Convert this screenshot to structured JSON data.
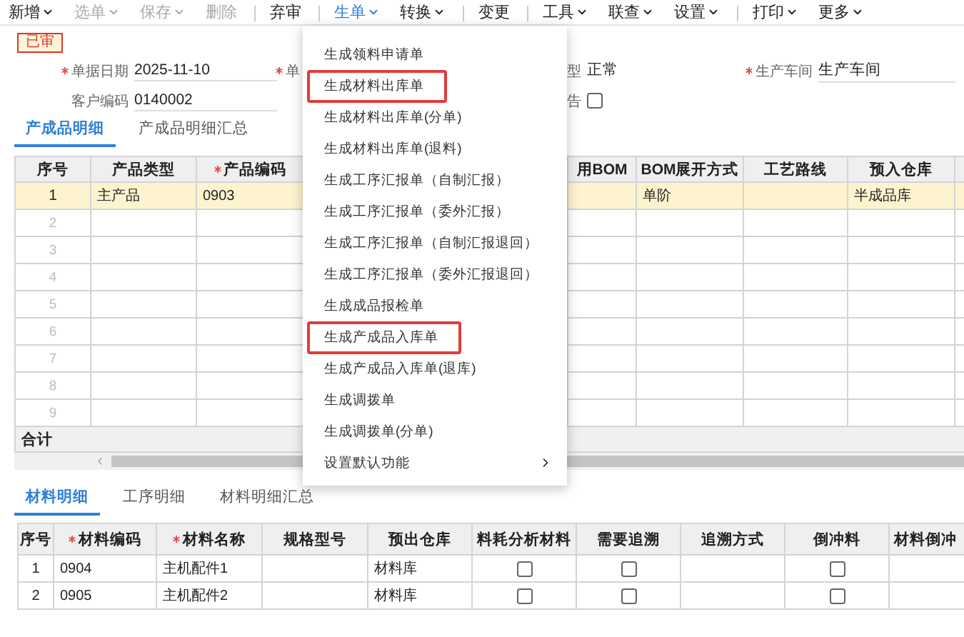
{
  "toolbar": [
    {
      "label": "新增",
      "caret": true,
      "disabled": false,
      "active": false,
      "divider_before": false
    },
    {
      "label": "选单",
      "caret": true,
      "disabled": true,
      "active": false,
      "divider_before": false
    },
    {
      "label": "保存",
      "caret": true,
      "disabled": true,
      "active": false,
      "divider_before": false
    },
    {
      "label": "删除",
      "caret": false,
      "disabled": true,
      "active": false,
      "divider_before": false
    },
    {
      "label": "弃审",
      "caret": false,
      "disabled": false,
      "active": false,
      "divider_before": true
    },
    {
      "label": "生单",
      "caret": true,
      "disabled": false,
      "active": true,
      "divider_before": true
    },
    {
      "label": "转换",
      "caret": true,
      "disabled": false,
      "active": false,
      "divider_before": false
    },
    {
      "label": "变更",
      "caret": false,
      "disabled": false,
      "active": false,
      "divider_before": true
    },
    {
      "label": "工具",
      "caret": true,
      "disabled": false,
      "active": false,
      "divider_before": true
    },
    {
      "label": "联查",
      "caret": true,
      "disabled": false,
      "active": false,
      "divider_before": false
    },
    {
      "label": "设置",
      "caret": true,
      "disabled": false,
      "active": false,
      "divider_before": false
    },
    {
      "label": "打印",
      "caret": true,
      "disabled": false,
      "active": false,
      "divider_before": true
    },
    {
      "label": "更多",
      "caret": true,
      "disabled": false,
      "active": false,
      "divider_before": false
    }
  ],
  "status_badge": "已审",
  "form": {
    "columns": [
      [
        {
          "kind": "text",
          "label": "单据日期",
          "required": true,
          "value": "2025-11-10"
        },
        {
          "kind": "text",
          "label": "客户编码",
          "required": false,
          "value": "0140002"
        }
      ],
      [
        {
          "kind": "text",
          "label": "单",
          "required": true
        }
      ],
      [
        {
          "kind": "text",
          "label": "型",
          "required": false,
          "value": "正常"
        },
        {
          "kind": "checkbox",
          "label": "告",
          "required": false,
          "checked": false
        }
      ],
      [
        {
          "kind": "text",
          "label": "生产车间",
          "required": true,
          "value": "生产车间"
        }
      ]
    ]
  },
  "product_tabs": [
    {
      "label": "产成品明细",
      "selected": true
    },
    {
      "label": "产成品明细汇总",
      "selected": false
    }
  ],
  "product_table": {
    "columns": [
      {
        "label": "序号",
        "required": false
      },
      {
        "label": "产品类型",
        "required": false
      },
      {
        "label": "产品编码",
        "required": true
      },
      {
        "label": "用BOM",
        "required": false
      },
      {
        "label": "BOM展开方式",
        "required": false
      },
      {
        "label": "工艺路线",
        "required": false
      },
      {
        "label": "预入仓库",
        "required": false
      }
    ],
    "rows": [
      {
        "cells": [
          "1",
          "主产品",
          "0903",
          null,
          "单阶",
          null,
          "半成品库"
        ],
        "selected": true
      },
      {
        "cells": [
          "2"
        ],
        "selected": false
      },
      {
        "cells": [
          "3"
        ],
        "selected": false
      },
      {
        "cells": [
          "4"
        ],
        "selected": false
      },
      {
        "cells": [
          "5"
        ],
        "selected": false
      },
      {
        "cells": [
          "6"
        ],
        "selected": false
      },
      {
        "cells": [
          "7"
        ],
        "selected": false
      },
      {
        "cells": [
          "8"
        ],
        "selected": false
      },
      {
        "cells": [
          "9"
        ],
        "selected": false
      }
    ],
    "total_label": "合计"
  },
  "menu": {
    "items": [
      {
        "label": "生成领料申请单",
        "highlighted": false,
        "submenu": false
      },
      {
        "label": "生成材料出库单",
        "highlighted": true,
        "submenu": false
      },
      {
        "label": "生成材料出库单(分单)",
        "highlighted": false,
        "submenu": false
      },
      {
        "label": "生成材料出库单(退料)",
        "highlighted": false,
        "submenu": false
      },
      {
        "label": "生成工序汇报单（自制汇报）",
        "highlighted": false,
        "submenu": false
      },
      {
        "label": "生成工序汇报单（委外汇报）",
        "highlighted": false,
        "submenu": false
      },
      {
        "label": "生成工序汇报单（自制汇报退回）",
        "highlighted": false,
        "submenu": false
      },
      {
        "label": "生成工序汇报单（委外汇报退回）",
        "highlighted": false,
        "submenu": false
      },
      {
        "label": "生成成品报检单",
        "highlighted": false,
        "submenu": false
      },
      {
        "label": "生成产成品入库单",
        "highlighted": true,
        "submenu": false
      },
      {
        "label": "生成产成品入库单(退库)",
        "highlighted": false,
        "submenu": false
      },
      {
        "label": "生成调拨单",
        "highlighted": false,
        "submenu": false
      },
      {
        "label": "生成调拨单(分单)",
        "highlighted": false,
        "submenu": false
      },
      {
        "label": "设置默认功能",
        "highlighted": false,
        "submenu": true
      }
    ]
  },
  "material_tabs": [
    {
      "label": "材料明细",
      "selected": true
    },
    {
      "label": "工序明细",
      "selected": false
    },
    {
      "label": "材料明细汇总",
      "selected": false
    }
  ],
  "material_table": {
    "columns": [
      {
        "label": "序号",
        "required": false,
        "kind": "text"
      },
      {
        "label": "材料编码",
        "required": true,
        "kind": "text"
      },
      {
        "label": "材料名称",
        "required": true,
        "kind": "text"
      },
      {
        "label": "规格型号",
        "required": false,
        "kind": "text"
      },
      {
        "label": "预出仓库",
        "required": false,
        "kind": "text"
      },
      {
        "label": "料耗分析材料",
        "required": false,
        "kind": "check"
      },
      {
        "label": "需要追溯",
        "required": false,
        "kind": "check"
      },
      {
        "label": "追溯方式",
        "required": false,
        "kind": "text"
      },
      {
        "label": "倒冲料",
        "required": false,
        "kind": "check"
      },
      {
        "label": "材料倒冲",
        "required": false,
        "kind": "text"
      }
    ],
    "rows": [
      {
        "cells": [
          "1",
          "0904",
          "主机配件1",
          null,
          "材料库",
          false,
          false,
          null,
          false,
          null
        ]
      },
      {
        "cells": [
          "2",
          "0905",
          "主机配件2",
          null,
          "材料库",
          false,
          false,
          null,
          false,
          null
        ]
      }
    ]
  }
}
